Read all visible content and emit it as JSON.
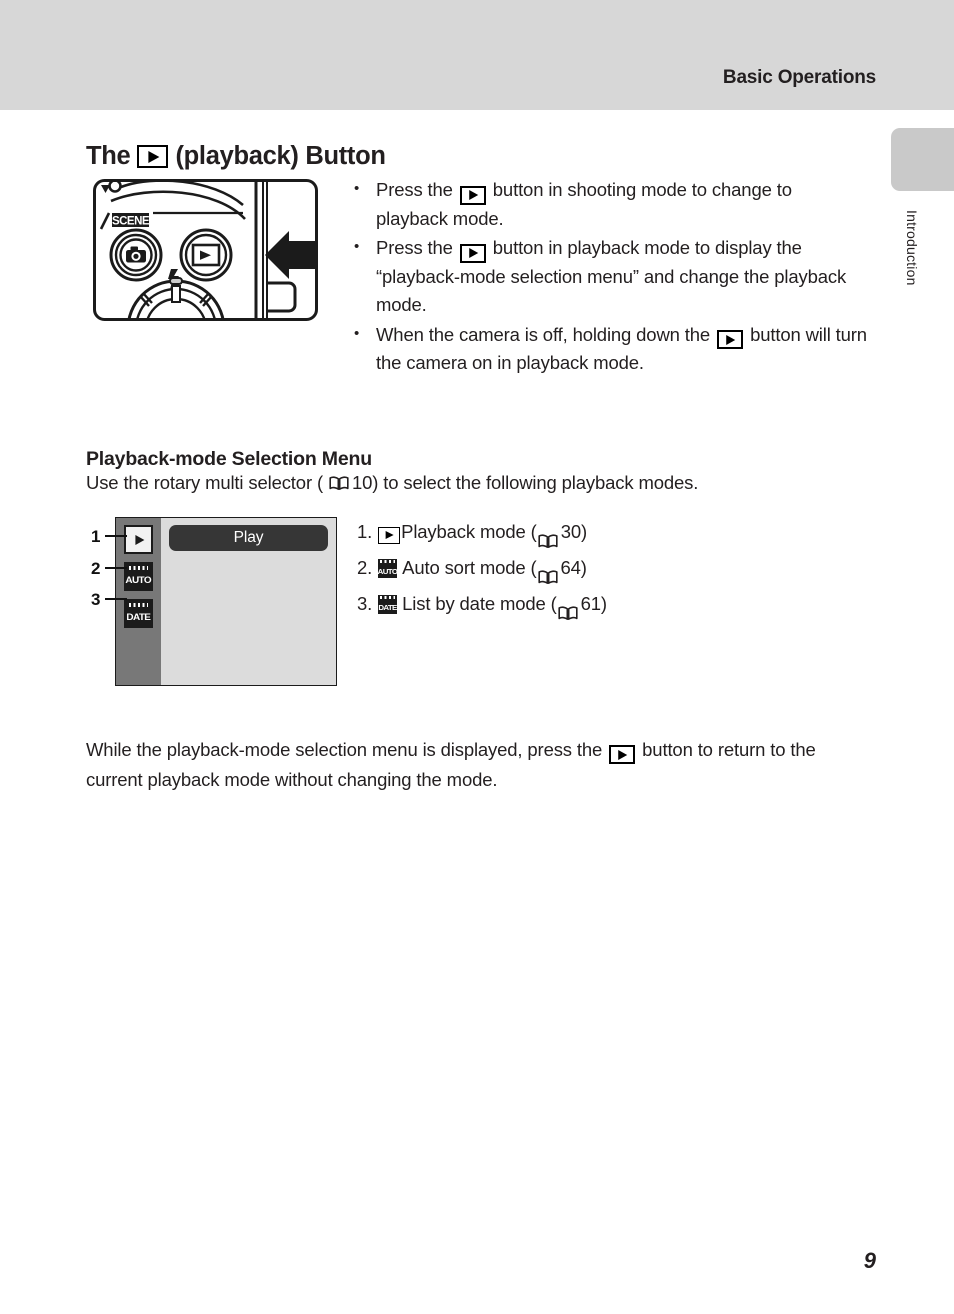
{
  "header": {
    "section_title": "Basic Operations"
  },
  "side_tab": {
    "label": "Introduction"
  },
  "page_title": {
    "before_icon": "The",
    "icon": "playback-button-icon",
    "after_icon": "(playback) Button"
  },
  "figure": {
    "name": "camera-rear-buttons-illustration",
    "scene_label": "SCENE",
    "shooting_button": "camera-icon",
    "playback_button": "playback-button-icon",
    "flash_marker": "flash-icon",
    "arrow": "left-pointing-arrow"
  },
  "bullets": [
    {
      "pre": "Press the",
      "icon": "playback-button-icon",
      "post": "button in shooting mode to change to playback mode."
    },
    {
      "pre": "Press the",
      "icon": "playback-button-icon",
      "post": "button in playback mode to display the “playback-mode selection menu” and change the playback mode."
    },
    {
      "pre": "When the camera is off, holding down the",
      "icon": "playback-button-icon",
      "post": "button will turn the camera on in playback mode."
    }
  ],
  "subsection": {
    "heading": "Playback-mode Selection Menu",
    "intro_pre": "Use the rotary multi selector (",
    "intro_ref_icon": "book-icon",
    "intro_ref_page": "10",
    "intro_post": ") to select the following playback modes."
  },
  "menu_mockup": {
    "name": "playback-mode-selection-menu-screen",
    "selected_label": "Play",
    "rail_items": [
      {
        "callout": "1",
        "icon": "playback-mode-icon",
        "type": "play"
      },
      {
        "callout": "2",
        "icon": "auto-sort-mode-icon",
        "type": "calendar",
        "word": "AUTO"
      },
      {
        "callout": "3",
        "icon": "list-by-date-mode-icon",
        "type": "calendar",
        "word": "DATE"
      }
    ]
  },
  "mode_list": [
    {
      "index": "1.",
      "icon": "playback-button-icon",
      "icon_type": "play",
      "label": "Playback mode (",
      "ref_icon": "book-icon",
      "page": "30",
      "close": ")"
    },
    {
      "index": "2.",
      "icon": "auto-sort-mode-icon",
      "icon_type": "calendar",
      "icon_word": "AUTO",
      "label": "Auto sort mode (",
      "ref_icon": "book-icon",
      "page": "64",
      "close": ")"
    },
    {
      "index": "3.",
      "icon": "list-by-date-mode-icon",
      "icon_type": "calendar",
      "icon_word": "DATE",
      "label": "List by date mode (",
      "ref_icon": "book-icon",
      "page": "61",
      "close": ")"
    }
  ],
  "closing": {
    "pre": "While the playback-mode selection menu is displayed, press the",
    "icon": "playback-button-icon",
    "post": "button to return to the current playback mode without changing the mode."
  },
  "page_number": "9",
  "colors": {
    "header_band": "#d7d7d7",
    "side_tab": "#c9c9c9",
    "menu_rail": "#787878",
    "menu_body": "#dcdcdc",
    "selected_pill": "#363636",
    "text": "#231f20"
  }
}
